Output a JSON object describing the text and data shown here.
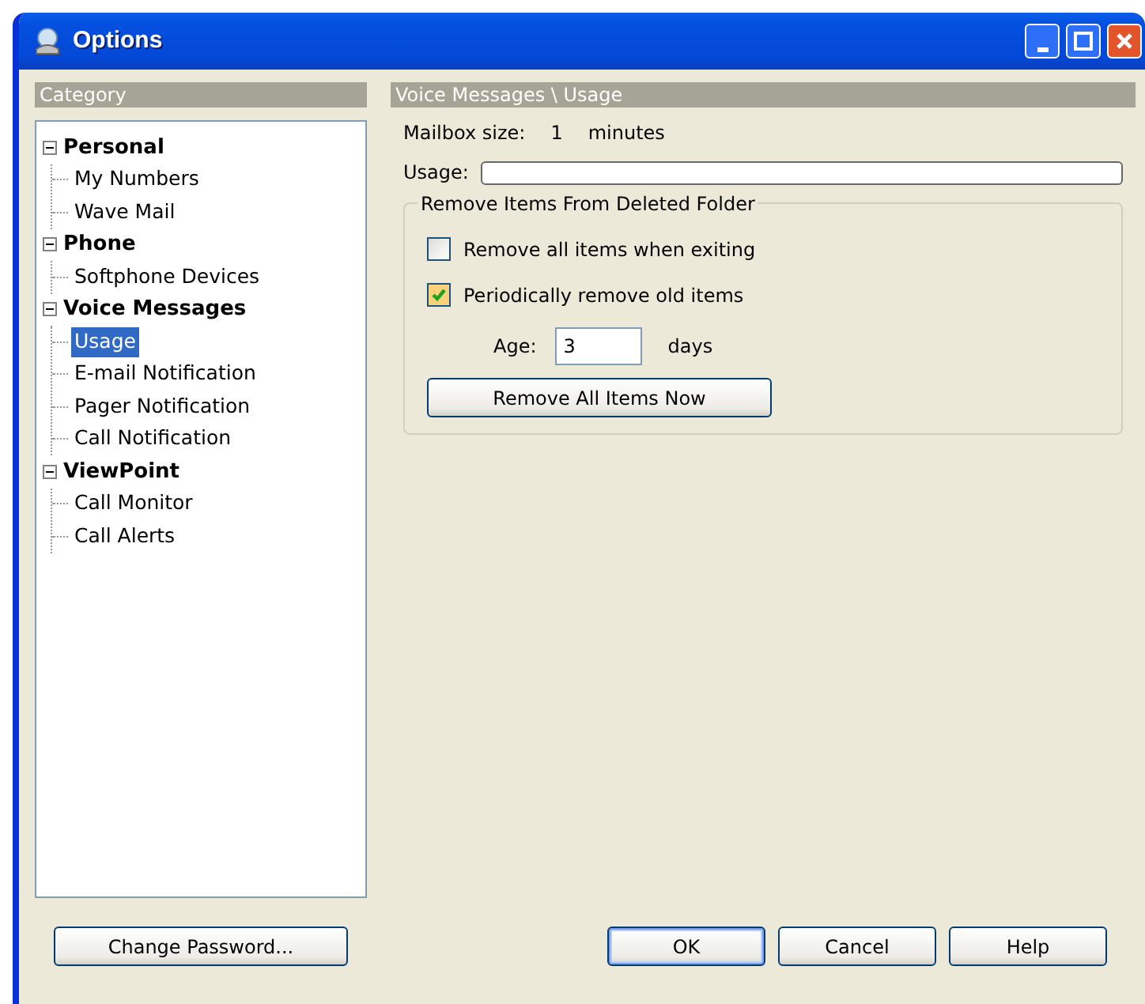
{
  "window": {
    "title": "Options"
  },
  "category_panel": {
    "header": "Category",
    "tree": [
      {
        "label": "Personal",
        "expanded": true,
        "selected": false,
        "children": [
          {
            "label": "My Numbers",
            "selected": false
          },
          {
            "label": "Wave Mail",
            "selected": false
          }
        ]
      },
      {
        "label": "Phone",
        "expanded": true,
        "selected": false,
        "children": [
          {
            "label": "Softphone Devices",
            "selected": false
          }
        ]
      },
      {
        "label": "Voice Messages",
        "expanded": true,
        "selected": false,
        "children": [
          {
            "label": "Usage",
            "selected": true
          },
          {
            "label": "E-mail Notification",
            "selected": false
          },
          {
            "label": "Pager Notification",
            "selected": false
          },
          {
            "label": "Call Notification",
            "selected": false
          }
        ]
      },
      {
        "label": "ViewPoint",
        "expanded": true,
        "selected": false,
        "children": [
          {
            "label": "Call Monitor",
            "selected": false
          },
          {
            "label": "Call Alerts",
            "selected": false
          }
        ]
      }
    ]
  },
  "content_panel": {
    "header": "Voice Messages \\ Usage",
    "mailbox_size": {
      "label": "Mailbox size:",
      "value": "1",
      "unit": "minutes"
    },
    "usage": {
      "label": "Usage:",
      "level": 0
    },
    "group": {
      "title": "Remove Items From Deleted Folder",
      "checkboxes": [
        {
          "label": "Remove all items when exiting",
          "checked": false
        },
        {
          "label": "Periodically remove old items",
          "checked": true
        }
      ],
      "age": {
        "label": "Age:",
        "value": "3",
        "unit": "days"
      },
      "button": "Remove All Items Now"
    }
  },
  "buttons": [
    {
      "label": "Change Password...",
      "default": false
    },
    {
      "label": "OK",
      "default": true
    },
    {
      "label": "Cancel",
      "default": false
    },
    {
      "label": "Help",
      "default": false
    }
  ]
}
